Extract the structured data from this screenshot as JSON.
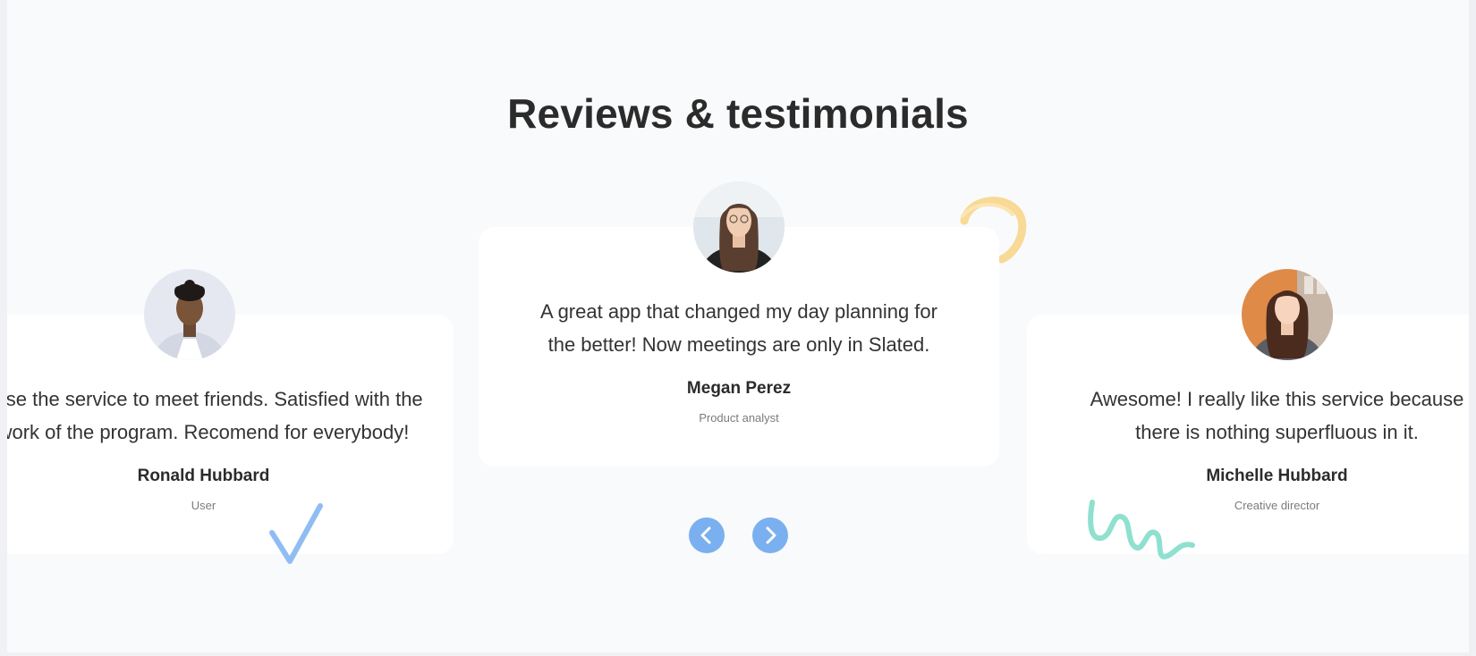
{
  "section": {
    "title": "Reviews & testimonials"
  },
  "testimonials": [
    {
      "quote_line1": "I use the service to meet friends. Satisfied with the",
      "quote_line2": "work of the program. Recomend for everybody!",
      "name": "Ronald Hubbard",
      "role": "User"
    },
    {
      "quote_line1": "A great app that changed my day planning for",
      "quote_line2": "the better! Now meetings are only in Slated.",
      "name": "Megan Perez",
      "role": "Product analyst"
    },
    {
      "quote_line1": "Awesome! I really like this service because",
      "quote_line2": "there is nothing superfluous in it.",
      "name": "Michelle Hubbard",
      "role": "Creative director"
    }
  ],
  "controls": {
    "prev_icon": "chevron-left-icon",
    "next_icon": "chevron-right-icon"
  },
  "colors": {
    "background": "#f9fafc",
    "card": "#ffffff",
    "accent": "#7ab0ef",
    "deco_yellow": "#f7d58a",
    "deco_blue": "#8fbdf3",
    "deco_green": "#8fe0cf"
  }
}
